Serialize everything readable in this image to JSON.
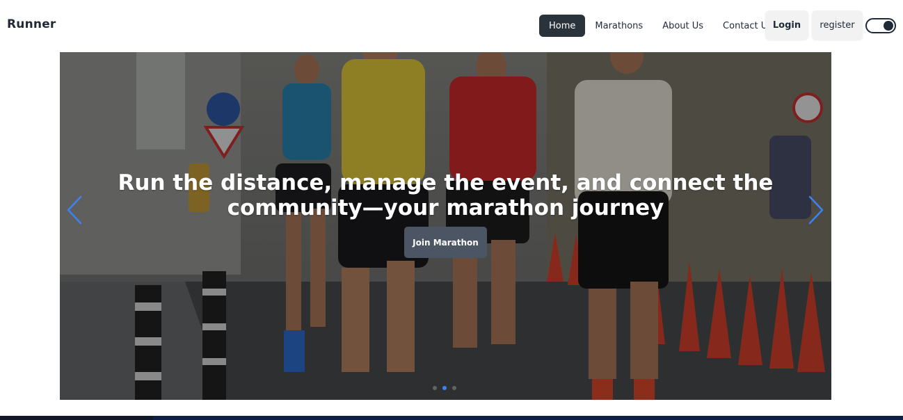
{
  "nav": {
    "brand": "Runner",
    "links": [
      {
        "label": "Home",
        "active": true
      },
      {
        "label": "Marathons",
        "active": false
      },
      {
        "label": "About Us",
        "active": false
      },
      {
        "label": "Contact Us",
        "active": false
      }
    ],
    "login_label": "Login",
    "register_label": "register",
    "theme_toggle_icon": "toggle-switch-icon"
  },
  "hero": {
    "title": "Run the distance, manage the event, and connect the community—your marathon journey",
    "cta_label": "Join Marathon",
    "prev_icon": "chevron-left-icon",
    "next_icon": "chevron-right-icon",
    "slide_count": 3,
    "active_slide": 2
  },
  "colors": {
    "active_nav_bg": "#2a323c",
    "arrow": "#3b82f6",
    "cta_bg": "#4b5563"
  }
}
